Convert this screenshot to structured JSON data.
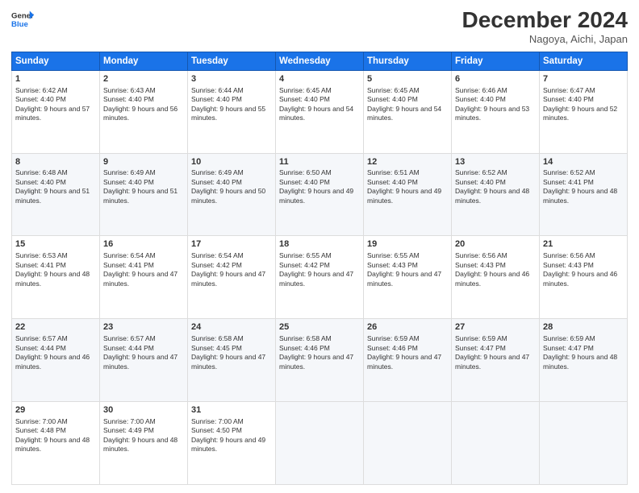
{
  "logo": {
    "line1": "General",
    "line2": "Blue"
  },
  "header": {
    "month": "December 2024",
    "location": "Nagoya, Aichi, Japan"
  },
  "weekdays": [
    "Sunday",
    "Monday",
    "Tuesday",
    "Wednesday",
    "Thursday",
    "Friday",
    "Saturday"
  ],
  "weeks": [
    [
      {
        "day": 1,
        "sunrise": "6:42 AM",
        "sunset": "4:40 PM",
        "daylight": "9 hours and 57 minutes."
      },
      {
        "day": 2,
        "sunrise": "6:43 AM",
        "sunset": "4:40 PM",
        "daylight": "9 hours and 56 minutes."
      },
      {
        "day": 3,
        "sunrise": "6:44 AM",
        "sunset": "4:40 PM",
        "daylight": "9 hours and 55 minutes."
      },
      {
        "day": 4,
        "sunrise": "6:45 AM",
        "sunset": "4:40 PM",
        "daylight": "9 hours and 54 minutes."
      },
      {
        "day": 5,
        "sunrise": "6:45 AM",
        "sunset": "4:40 PM",
        "daylight": "9 hours and 54 minutes."
      },
      {
        "day": 6,
        "sunrise": "6:46 AM",
        "sunset": "4:40 PM",
        "daylight": "9 hours and 53 minutes."
      },
      {
        "day": 7,
        "sunrise": "6:47 AM",
        "sunset": "4:40 PM",
        "daylight": "9 hours and 52 minutes."
      }
    ],
    [
      {
        "day": 8,
        "sunrise": "6:48 AM",
        "sunset": "4:40 PM",
        "daylight": "9 hours and 51 minutes."
      },
      {
        "day": 9,
        "sunrise": "6:49 AM",
        "sunset": "4:40 PM",
        "daylight": "9 hours and 51 minutes."
      },
      {
        "day": 10,
        "sunrise": "6:49 AM",
        "sunset": "4:40 PM",
        "daylight": "9 hours and 50 minutes."
      },
      {
        "day": 11,
        "sunrise": "6:50 AM",
        "sunset": "4:40 PM",
        "daylight": "9 hours and 49 minutes."
      },
      {
        "day": 12,
        "sunrise": "6:51 AM",
        "sunset": "4:40 PM",
        "daylight": "9 hours and 49 minutes."
      },
      {
        "day": 13,
        "sunrise": "6:52 AM",
        "sunset": "4:40 PM",
        "daylight": "9 hours and 48 minutes."
      },
      {
        "day": 14,
        "sunrise": "6:52 AM",
        "sunset": "4:41 PM",
        "daylight": "9 hours and 48 minutes."
      }
    ],
    [
      {
        "day": 15,
        "sunrise": "6:53 AM",
        "sunset": "4:41 PM",
        "daylight": "9 hours and 48 minutes."
      },
      {
        "day": 16,
        "sunrise": "6:54 AM",
        "sunset": "4:41 PM",
        "daylight": "9 hours and 47 minutes."
      },
      {
        "day": 17,
        "sunrise": "6:54 AM",
        "sunset": "4:42 PM",
        "daylight": "9 hours and 47 minutes."
      },
      {
        "day": 18,
        "sunrise": "6:55 AM",
        "sunset": "4:42 PM",
        "daylight": "9 hours and 47 minutes."
      },
      {
        "day": 19,
        "sunrise": "6:55 AM",
        "sunset": "4:43 PM",
        "daylight": "9 hours and 47 minutes."
      },
      {
        "day": 20,
        "sunrise": "6:56 AM",
        "sunset": "4:43 PM",
        "daylight": "9 hours and 46 minutes."
      },
      {
        "day": 21,
        "sunrise": "6:56 AM",
        "sunset": "4:43 PM",
        "daylight": "9 hours and 46 minutes."
      }
    ],
    [
      {
        "day": 22,
        "sunrise": "6:57 AM",
        "sunset": "4:44 PM",
        "daylight": "9 hours and 46 minutes."
      },
      {
        "day": 23,
        "sunrise": "6:57 AM",
        "sunset": "4:44 PM",
        "daylight": "9 hours and 47 minutes."
      },
      {
        "day": 24,
        "sunrise": "6:58 AM",
        "sunset": "4:45 PM",
        "daylight": "9 hours and 47 minutes."
      },
      {
        "day": 25,
        "sunrise": "6:58 AM",
        "sunset": "4:46 PM",
        "daylight": "9 hours and 47 minutes."
      },
      {
        "day": 26,
        "sunrise": "6:59 AM",
        "sunset": "4:46 PM",
        "daylight": "9 hours and 47 minutes."
      },
      {
        "day": 27,
        "sunrise": "6:59 AM",
        "sunset": "4:47 PM",
        "daylight": "9 hours and 47 minutes."
      },
      {
        "day": 28,
        "sunrise": "6:59 AM",
        "sunset": "4:47 PM",
        "daylight": "9 hours and 48 minutes."
      }
    ],
    [
      {
        "day": 29,
        "sunrise": "7:00 AM",
        "sunset": "4:48 PM",
        "daylight": "9 hours and 48 minutes."
      },
      {
        "day": 30,
        "sunrise": "7:00 AM",
        "sunset": "4:49 PM",
        "daylight": "9 hours and 48 minutes."
      },
      {
        "day": 31,
        "sunrise": "7:00 AM",
        "sunset": "4:50 PM",
        "daylight": "9 hours and 49 minutes."
      },
      null,
      null,
      null,
      null
    ]
  ]
}
